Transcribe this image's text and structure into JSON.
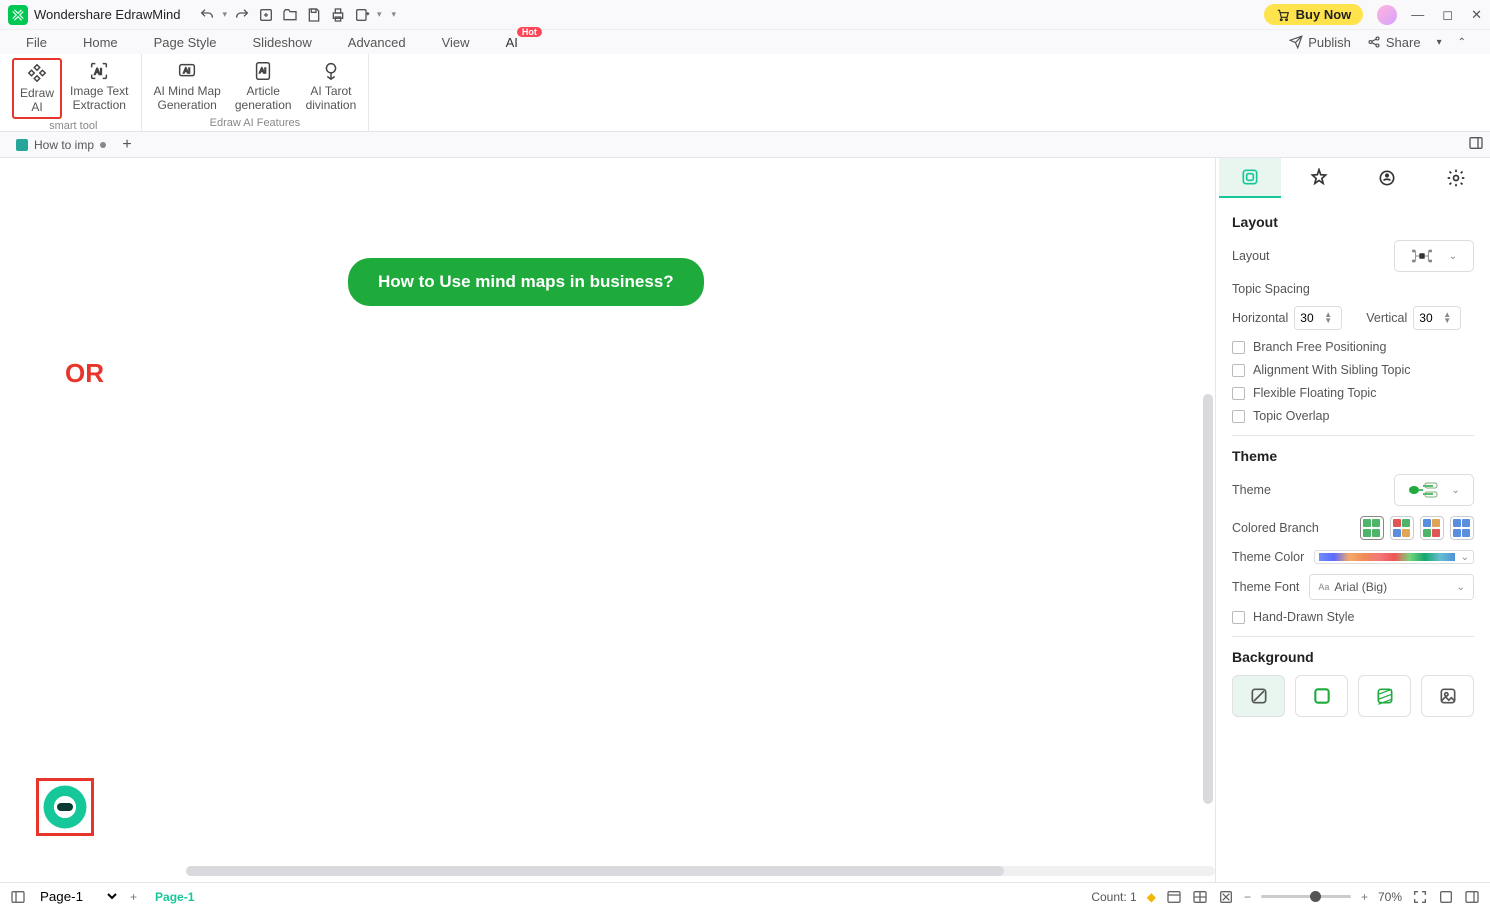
{
  "titlebar": {
    "app_title": "Wondershare EdrawMind",
    "buy": "Buy Now"
  },
  "menubar": {
    "tabs": [
      "File",
      "Home",
      "Page Style",
      "Slideshow",
      "Advanced",
      "View",
      "AI"
    ],
    "hot": "Hot",
    "publish": "Publish",
    "share": "Share"
  },
  "ribbon": {
    "smart_tool_cap": "smart tool",
    "ai_features_cap": "Edraw AI Features",
    "items": {
      "edraw_ai1": "Edraw",
      "edraw_ai2": "AI",
      "img_text1": "Image Text",
      "img_text2": "Extraction",
      "mindmap1": "AI Mind Map",
      "mindmap2": "Generation",
      "article1": "Article",
      "article2": "generation",
      "tarot1": "AI Tarot",
      "tarot2": "divination"
    }
  },
  "doctabs": {
    "tab1": "How to imp"
  },
  "canvas": {
    "central_topic": "How to Use mind maps in business?",
    "or_label": "OR"
  },
  "sidepanel": {
    "layout_h": "Layout",
    "layout_lbl": "Layout",
    "topic_spacing": "Topic Spacing",
    "horizontal": "Horizontal",
    "vertical": "Vertical",
    "h_val": "30",
    "v_val": "30",
    "chk_branch": "Branch Free Positioning",
    "chk_align": "Alignment With Sibling Topic",
    "chk_flex": "Flexible Floating Topic",
    "chk_overlap": "Topic Overlap",
    "theme_h": "Theme",
    "theme_lbl": "Theme",
    "colored_branch": "Colored Branch",
    "theme_color": "Theme Color",
    "theme_font": "Theme Font",
    "font_val": "Arial (Big)",
    "hand_drawn": "Hand-Drawn Style",
    "bg_h": "Background"
  },
  "statusbar": {
    "page_sel": "Page-1",
    "page_tab": "Page-1",
    "count": "Count: 1",
    "zoom": "70%"
  }
}
